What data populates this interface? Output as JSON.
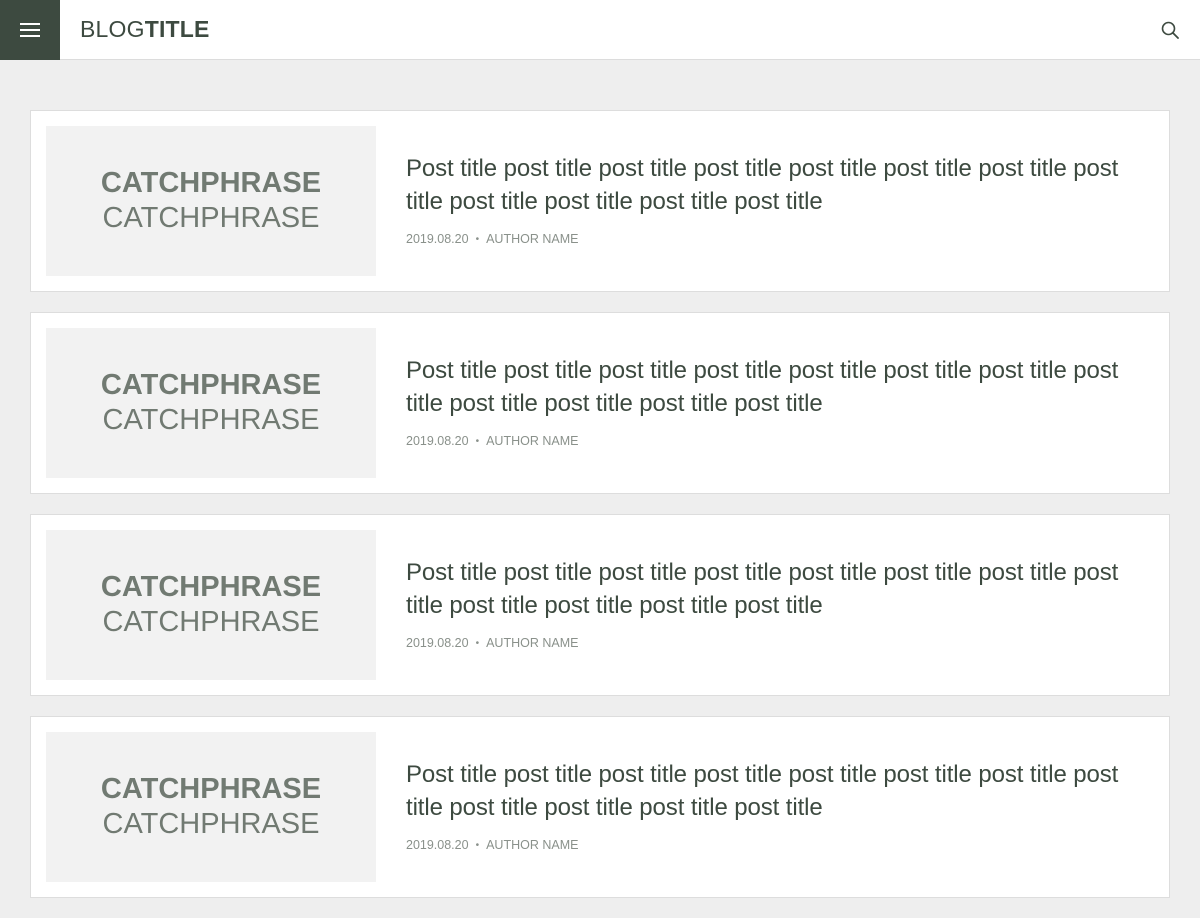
{
  "header": {
    "brand_light": "BLOG",
    "brand_bold": "TITLE",
    "menu_icon": "hamburger-icon",
    "search_icon": "search-icon"
  },
  "posts": [
    {
      "thumb_line1": "CATCHPHRASE",
      "thumb_line2": "CATCHPHRASE",
      "title": "Post title post title post title post title post title post title post title post title post title post title post title post title",
      "date": "2019.08.20",
      "separator": "•",
      "author": "AUTHOR NAME"
    },
    {
      "thumb_line1": "CATCHPHRASE",
      "thumb_line2": "CATCHPHRASE",
      "title": "Post title post title post title post title post title post title post title post title post title post title post title post title",
      "date": "2019.08.20",
      "separator": "•",
      "author": "AUTHOR NAME"
    },
    {
      "thumb_line1": "CATCHPHRASE",
      "thumb_line2": "CATCHPHRASE",
      "title": "Post title post title post title post title post title post title post title post title post title post title post title post title",
      "date": "2019.08.20",
      "separator": "•",
      "author": "AUTHOR NAME"
    },
    {
      "thumb_line1": "CATCHPHRASE",
      "thumb_line2": "CATCHPHRASE",
      "title": "Post title post title post title post title post title post title post title post title post title post title post title post title",
      "date": "2019.08.20",
      "separator": "•",
      "author": "AUTHOR NAME"
    }
  ],
  "colors": {
    "accent": "#3d4a40",
    "background": "#eeeeee",
    "card": "#ffffff",
    "thumb_bg": "#f2f2f2",
    "meta_text": "#8a918b"
  }
}
